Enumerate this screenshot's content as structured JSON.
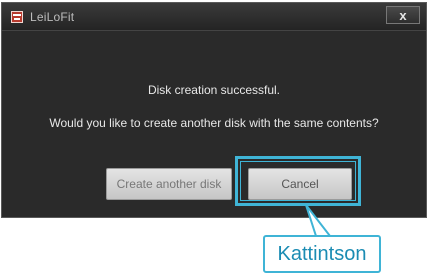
{
  "window": {
    "title": "LeiLoFit",
    "close_label": "x"
  },
  "dialog": {
    "message_primary": "Disk creation successful.",
    "message_secondary": "Would you like to create another disk with the same contents?",
    "buttons": {
      "create_another_label": "Create another disk",
      "cancel_label": "Cancel"
    }
  },
  "annotation": {
    "callout_text": "Kattintson",
    "accent_color": "#3fb4d6"
  },
  "icons": {
    "app_icon": "app-logo-icon",
    "close_icon": "close-icon"
  }
}
